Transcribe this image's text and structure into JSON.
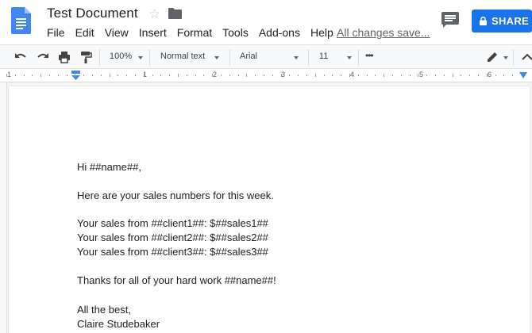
{
  "header": {
    "title": "Test Document",
    "saved_status": "All changes save...",
    "share_label": "SHARE"
  },
  "menu": [
    "File",
    "Edit",
    "View",
    "Insert",
    "Format",
    "Tools",
    "Add-ons",
    "Help"
  ],
  "toolbar": {
    "zoom": "100%",
    "style": "Normal text",
    "font": "Arial",
    "size": "11",
    "more": "•••"
  },
  "ruler": {
    "numbers": [
      "1",
      "1",
      "2",
      "3",
      "4",
      "5",
      "6"
    ]
  },
  "document": {
    "lines": [
      "Hi ##name##,",
      "Here are your sales numbers for this week.",
      "Your sales from ##client1##: $##sales1##",
      "Your sales from ##client2##: $##sales2##",
      "Your sales from ##client3##: $##sales3##",
      "Thanks for all of your hard work ##name##!",
      "All the best,",
      "Claire Studebaker"
    ]
  },
  "colors": {
    "accent": "#1a73e8",
    "docs_blue": "#4285f4"
  },
  "icons": [
    "docs-logo-icon",
    "star-icon",
    "folder-icon",
    "comment-icon",
    "lock-icon",
    "undo-icon",
    "redo-icon",
    "print-icon",
    "paint-format-icon",
    "pencil-icon",
    "chevron-up-icon"
  ]
}
